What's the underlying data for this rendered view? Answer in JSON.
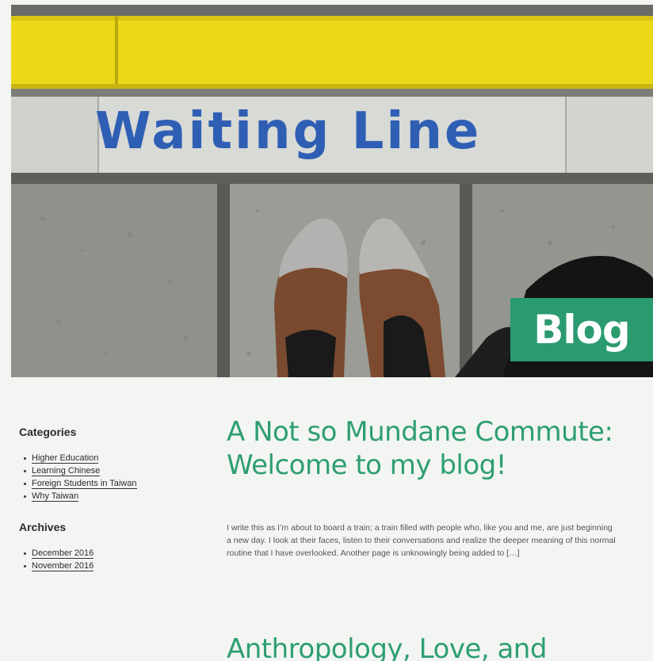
{
  "colors": {
    "accent": "#2e9e72",
    "badge": "#2a9b6e",
    "hero_text": "#2f5fb4",
    "background": "#f3f5f2"
  },
  "hero": {
    "painted_text": "Waiting Line",
    "badge_label": "Blog"
  },
  "sidebar": {
    "categories_title": "Categories",
    "categories": [
      "Higher Education",
      "Learning Chinese",
      "Foreign Students in Taiwan",
      "Why Taiwan"
    ],
    "archives_title": "Archives",
    "archives": [
      "December 2016",
      "November 2016"
    ]
  },
  "posts": [
    {
      "title_line1": "A Not so Mundane Commute:",
      "title_line2": "Welcome to my blog!",
      "excerpt": "I write this as I’m about to board a train; a train filled with people who, like you and me, are just beginning a new day. I look at their faces, listen to their conversations and realize the deeper meaning of this normal routine that I have overlooked. Another page is unknowingly being added to […]"
    },
    {
      "title_line1": "Anthropology, Love, and"
    }
  ]
}
